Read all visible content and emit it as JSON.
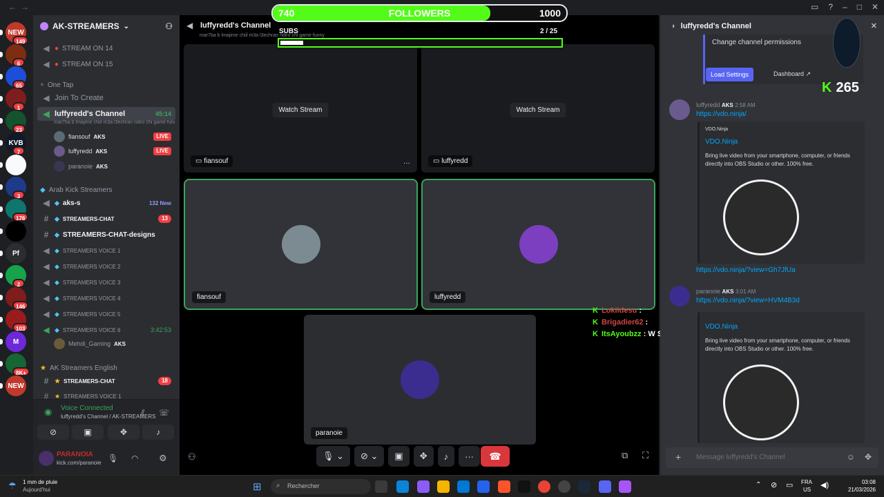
{
  "window": {
    "back": "←",
    "forward": "→"
  },
  "rail": {
    "items": [
      {
        "label": "NEW",
        "badge": "149"
      },
      {
        "label": "",
        "badge": "6"
      },
      {
        "label": "",
        "badge": "65"
      },
      {
        "label": "",
        "badge": "1"
      },
      {
        "label": "",
        "badge": "23"
      },
      {
        "label": "KVB",
        "badge": "7"
      },
      {
        "label": "",
        "badge": ""
      },
      {
        "label": "",
        "badge": "3"
      },
      {
        "label": "",
        "badge": "176"
      },
      {
        "label": "",
        "badge": ""
      },
      {
        "label": "Pf",
        "badge": ""
      },
      {
        "label": "",
        "badge": "2"
      },
      {
        "label": "",
        "badge": "146"
      },
      {
        "label": "",
        "badge": "103"
      },
      {
        "label": "M",
        "badge": ""
      },
      {
        "label": "",
        "badge": "8K+"
      },
      {
        "label": "NEW",
        "badge": ""
      }
    ]
  },
  "server": {
    "name": "AK-STREAMERS",
    "chevron": "⌄"
  },
  "channels": {
    "stream14": "STREAM ON 14",
    "stream15": "STREAM ON 15",
    "cat_onetap": "One Tap",
    "join_create": "Join To Create",
    "luffy_channel": "luffyredd's Channel",
    "luffy_timer": "45:14",
    "luffy_status": "mar7ba b lmajime chiil m3a l3echran ndiro chi game funny",
    "users": [
      {
        "name": "fiansouf",
        "tag": "AKS",
        "live": "LIVE"
      },
      {
        "name": "luffyredd",
        "tag": "AKS",
        "live": "LIVE"
      },
      {
        "name": "paranoie",
        "tag": "AKS",
        "live": ""
      }
    ],
    "cat_arab": "Arab Kick Streamers",
    "aks_s": "aks-s",
    "aks_s_new": "132 New",
    "streamers_chat": "STREAMERS-CHAT",
    "streamers_chat_count": "13",
    "streamers_chat_designs": "STREAMERS-CHAT-designs",
    "voice1": "STREAMERS VOICE 1",
    "voice2": "STREAMERS VOICE 2",
    "voice3": "STREAMERS VOICE 3",
    "voice4": "STREAMERS VOICE 4",
    "voice5": "STREAMERS VOICE 5",
    "voice6": "STREAMERS VOICE 6",
    "voice6_timer": "3:42:53",
    "mehdi": "Mehdi_Gaming",
    "mehdi_tag": "AKS",
    "cat_english": "AK Streamers English",
    "en_chat": "STREAMERS-CHAT",
    "en_chat_count": "18",
    "en_voice1": "STREAMERS VOICE 1"
  },
  "voice": {
    "title": "Voice Connected",
    "sub": "luffyredd's Channel / AK-STREAMERS",
    "username": "PARANOIA",
    "status": "kick.com/paranoie"
  },
  "stage": {
    "title": "luffyredd's Channel",
    "subtitle": "mar7ba b lmajime chiil m3a l3echran ndiro chi game funny",
    "watch_label": "Watch Stream",
    "tiles": {
      "fiansouf_stream": "fiansouf",
      "luffy_stream": "luffyredd",
      "fiansouf_cam": "fiansouf",
      "luffy_cam": "luffyredd",
      "paranoie_cam": "paranoie"
    },
    "more": "···"
  },
  "overlay": {
    "followers_current": "740",
    "followers_label": "FOLLOWERS",
    "followers_goal": "1000",
    "followers_progress": 0.74,
    "subs_label": "SUBS",
    "subs_count": "2  / 25",
    "subs_progress": 0.08,
    "chat": [
      {
        "user": "Lokiidesu",
        "sep": " : ",
        "msg": ""
      },
      {
        "user": "Brigadier62",
        "sep": " : ",
        "msg": ""
      },
      {
        "user": "ItsAyoubzz",
        "sep": " : ",
        "msg": "W Stream"
      }
    ],
    "kick_count": "265",
    "kick_letter": "K"
  },
  "chat": {
    "channel": "luffyredd's Channel",
    "perm": "Change channel permissions",
    "load_settings": "Load Settings",
    "dashboard": "Dashboard",
    "msg1_user": "luffyredd",
    "msg1_tag": "AKS",
    "msg1_time": "2:58 AM",
    "msg1_link": "https://vdo.ninja/",
    "embed_provider": "VDO.Ninja",
    "embed_title": "VDO.Ninja",
    "embed_desc": "Bring live video from your smartphone, computer, or friends directly into OBS Studio or other. 100% free.",
    "msg2_link": "https://vdo.ninja/?view=Gh7JfUa",
    "msg3_user": "paranoie",
    "msg3_tag": "AKS",
    "msg3_time": "3:01 AM",
    "msg3_link": "https://vdo.ninja/?view=HVM4B3d",
    "placeholder": "Message  luffyredd's Channel"
  },
  "taskbar": {
    "weather": "1 mm de pluie",
    "weather_sub": "Aujourd'hui",
    "search": "Rechercher",
    "lang1": "FRA",
    "lang2": "US",
    "time": "03:08",
    "date": "21/03/2026"
  },
  "colors": {
    "kick_green": "#53fc18",
    "discord_blurple": "#5865f2",
    "live_red": "#f23f43"
  }
}
